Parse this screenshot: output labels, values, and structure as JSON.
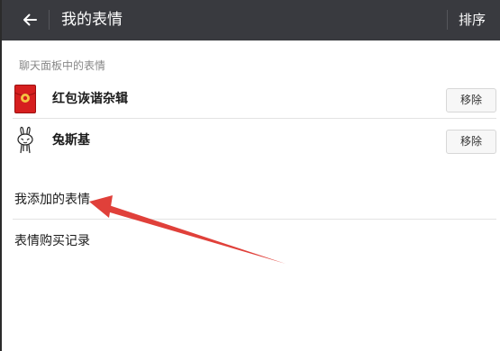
{
  "header": {
    "title": "我的表情",
    "sort_label": "排序"
  },
  "section": {
    "label": "聊天面板中的表情"
  },
  "stickers": [
    {
      "name": "红包诙谐杂辑",
      "action": "移除",
      "icon": "red-envelope-icon"
    },
    {
      "name": "兔斯基",
      "action": "移除",
      "icon": "tuzki-icon"
    }
  ],
  "links": {
    "added": "我添加的表情",
    "history": "表情购买记录"
  },
  "colors": {
    "topbar": "#393a3f",
    "annotation": "#e0403a",
    "red_envelope": "#d61f1f"
  }
}
